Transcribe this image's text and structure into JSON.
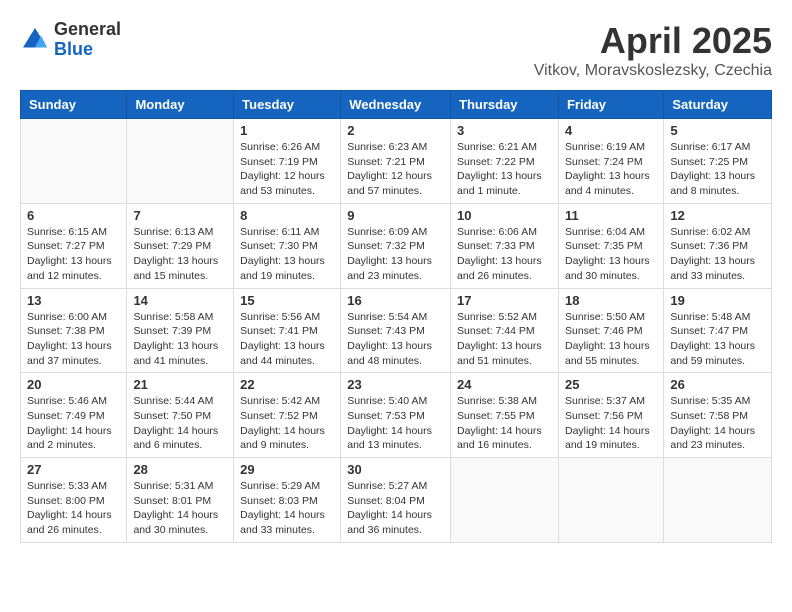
{
  "logo": {
    "general": "General",
    "blue": "Blue"
  },
  "title": {
    "month_year": "April 2025",
    "location": "Vitkov, Moravskoslezsky, Czechia"
  },
  "weekdays": [
    "Sunday",
    "Monday",
    "Tuesday",
    "Wednesday",
    "Thursday",
    "Friday",
    "Saturday"
  ],
  "weeks": [
    [
      {
        "day": "",
        "info": ""
      },
      {
        "day": "",
        "info": ""
      },
      {
        "day": "1",
        "info": "Sunrise: 6:26 AM\nSunset: 7:19 PM\nDaylight: 12 hours and 53 minutes."
      },
      {
        "day": "2",
        "info": "Sunrise: 6:23 AM\nSunset: 7:21 PM\nDaylight: 12 hours and 57 minutes."
      },
      {
        "day": "3",
        "info": "Sunrise: 6:21 AM\nSunset: 7:22 PM\nDaylight: 13 hours and 1 minute."
      },
      {
        "day": "4",
        "info": "Sunrise: 6:19 AM\nSunset: 7:24 PM\nDaylight: 13 hours and 4 minutes."
      },
      {
        "day": "5",
        "info": "Sunrise: 6:17 AM\nSunset: 7:25 PM\nDaylight: 13 hours and 8 minutes."
      }
    ],
    [
      {
        "day": "6",
        "info": "Sunrise: 6:15 AM\nSunset: 7:27 PM\nDaylight: 13 hours and 12 minutes."
      },
      {
        "day": "7",
        "info": "Sunrise: 6:13 AM\nSunset: 7:29 PM\nDaylight: 13 hours and 15 minutes."
      },
      {
        "day": "8",
        "info": "Sunrise: 6:11 AM\nSunset: 7:30 PM\nDaylight: 13 hours and 19 minutes."
      },
      {
        "day": "9",
        "info": "Sunrise: 6:09 AM\nSunset: 7:32 PM\nDaylight: 13 hours and 23 minutes."
      },
      {
        "day": "10",
        "info": "Sunrise: 6:06 AM\nSunset: 7:33 PM\nDaylight: 13 hours and 26 minutes."
      },
      {
        "day": "11",
        "info": "Sunrise: 6:04 AM\nSunset: 7:35 PM\nDaylight: 13 hours and 30 minutes."
      },
      {
        "day": "12",
        "info": "Sunrise: 6:02 AM\nSunset: 7:36 PM\nDaylight: 13 hours and 33 minutes."
      }
    ],
    [
      {
        "day": "13",
        "info": "Sunrise: 6:00 AM\nSunset: 7:38 PM\nDaylight: 13 hours and 37 minutes."
      },
      {
        "day": "14",
        "info": "Sunrise: 5:58 AM\nSunset: 7:39 PM\nDaylight: 13 hours and 41 minutes."
      },
      {
        "day": "15",
        "info": "Sunrise: 5:56 AM\nSunset: 7:41 PM\nDaylight: 13 hours and 44 minutes."
      },
      {
        "day": "16",
        "info": "Sunrise: 5:54 AM\nSunset: 7:43 PM\nDaylight: 13 hours and 48 minutes."
      },
      {
        "day": "17",
        "info": "Sunrise: 5:52 AM\nSunset: 7:44 PM\nDaylight: 13 hours and 51 minutes."
      },
      {
        "day": "18",
        "info": "Sunrise: 5:50 AM\nSunset: 7:46 PM\nDaylight: 13 hours and 55 minutes."
      },
      {
        "day": "19",
        "info": "Sunrise: 5:48 AM\nSunset: 7:47 PM\nDaylight: 13 hours and 59 minutes."
      }
    ],
    [
      {
        "day": "20",
        "info": "Sunrise: 5:46 AM\nSunset: 7:49 PM\nDaylight: 14 hours and 2 minutes."
      },
      {
        "day": "21",
        "info": "Sunrise: 5:44 AM\nSunset: 7:50 PM\nDaylight: 14 hours and 6 minutes."
      },
      {
        "day": "22",
        "info": "Sunrise: 5:42 AM\nSunset: 7:52 PM\nDaylight: 14 hours and 9 minutes."
      },
      {
        "day": "23",
        "info": "Sunrise: 5:40 AM\nSunset: 7:53 PM\nDaylight: 14 hours and 13 minutes."
      },
      {
        "day": "24",
        "info": "Sunrise: 5:38 AM\nSunset: 7:55 PM\nDaylight: 14 hours and 16 minutes."
      },
      {
        "day": "25",
        "info": "Sunrise: 5:37 AM\nSunset: 7:56 PM\nDaylight: 14 hours and 19 minutes."
      },
      {
        "day": "26",
        "info": "Sunrise: 5:35 AM\nSunset: 7:58 PM\nDaylight: 14 hours and 23 minutes."
      }
    ],
    [
      {
        "day": "27",
        "info": "Sunrise: 5:33 AM\nSunset: 8:00 PM\nDaylight: 14 hours and 26 minutes."
      },
      {
        "day": "28",
        "info": "Sunrise: 5:31 AM\nSunset: 8:01 PM\nDaylight: 14 hours and 30 minutes."
      },
      {
        "day": "29",
        "info": "Sunrise: 5:29 AM\nSunset: 8:03 PM\nDaylight: 14 hours and 33 minutes."
      },
      {
        "day": "30",
        "info": "Sunrise: 5:27 AM\nSunset: 8:04 PM\nDaylight: 14 hours and 36 minutes."
      },
      {
        "day": "",
        "info": ""
      },
      {
        "day": "",
        "info": ""
      },
      {
        "day": "",
        "info": ""
      }
    ]
  ]
}
